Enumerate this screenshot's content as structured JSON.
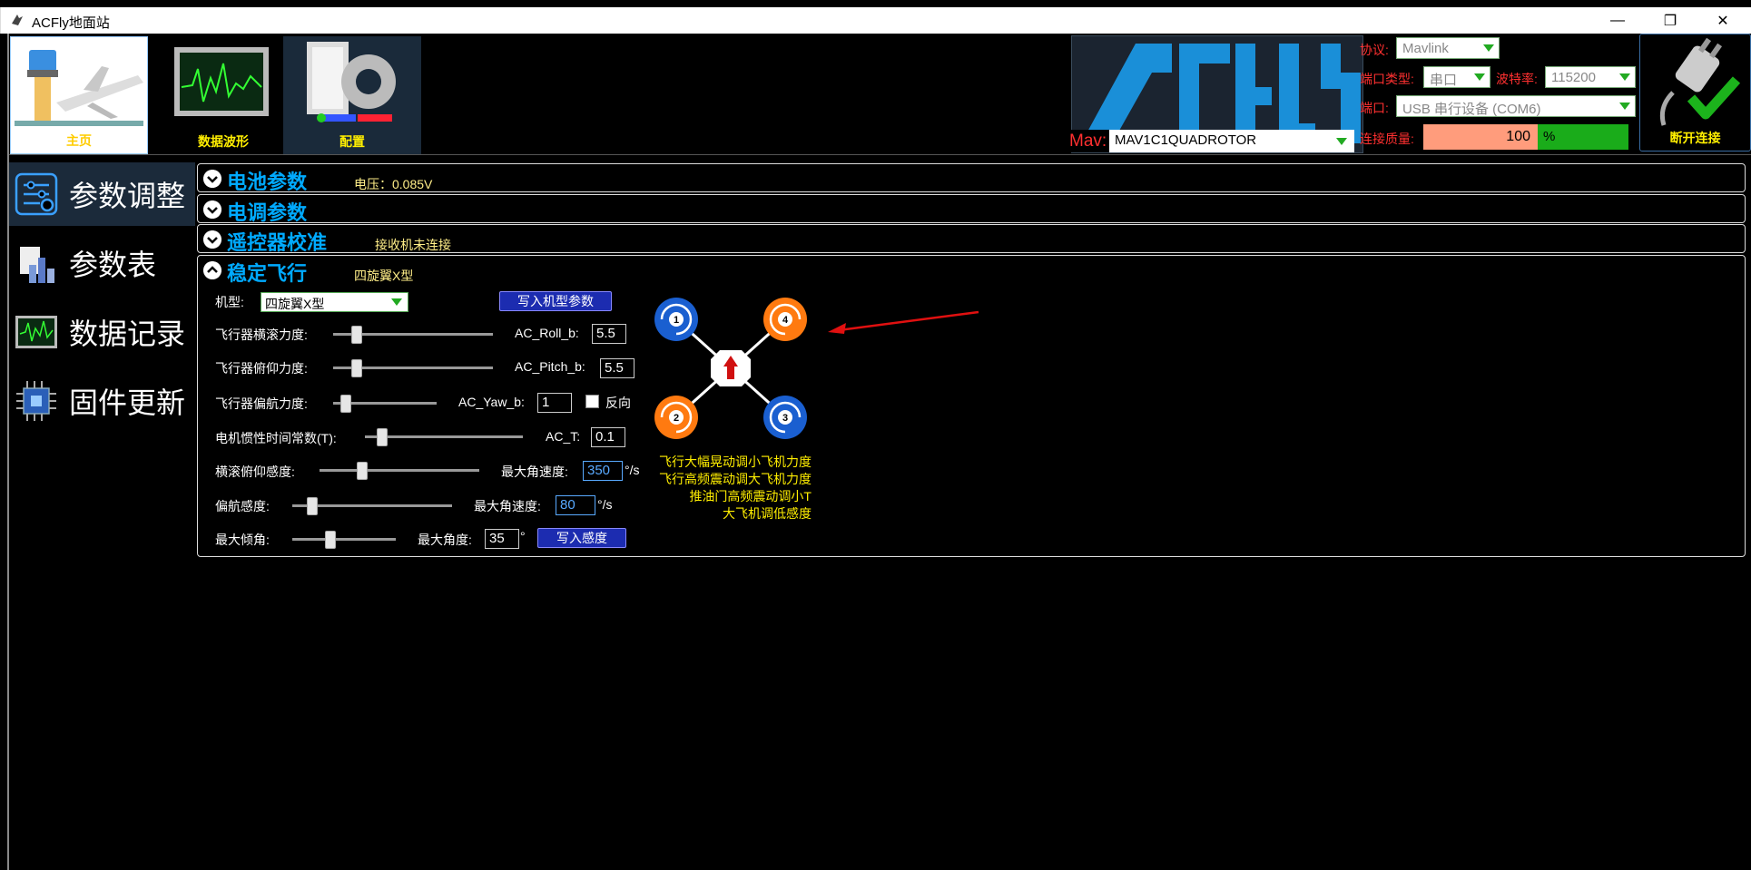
{
  "window": {
    "title": "ACFly地面站",
    "minimize": "—",
    "maximize": "❐",
    "close": "✕"
  },
  "toolbar": {
    "home_label": "主页",
    "wave_label": "数据波形",
    "config_label": "配置",
    "disconnect_label": "断开连接"
  },
  "connection": {
    "protocol_label": "协议:",
    "protocol_value": "Mavlink",
    "port_type_label": "端口类型:",
    "port_type_value": "串口",
    "baud_label": "波特率:",
    "baud_value": "115200",
    "port_label": "端口:",
    "port_value": "USB 串行设备 (COM6)",
    "quality_label": "连接质量:",
    "quality_value": "100",
    "quality_unit": "%",
    "mav_label": "Mav:",
    "mav_value": "MAV1C1QUADROTOR"
  },
  "sidebar": {
    "items": [
      {
        "label": "参数调整",
        "icon": "sliders-icon"
      },
      {
        "label": "参数表",
        "icon": "bar-chart-icon"
      },
      {
        "label": "数据记录",
        "icon": "monitor-wave-icon"
      },
      {
        "label": "固件更新",
        "icon": "chip-icon"
      }
    ]
  },
  "panels": {
    "battery": {
      "title": "电池参数",
      "sub": "电压：0.085V"
    },
    "esc": {
      "title": "电调参数"
    },
    "rc": {
      "title": "遥控器校准",
      "sub": "接收机未连接"
    },
    "stable": {
      "title": "稳定飞行",
      "sub": "四旋翼X型",
      "frame_label": "机型:",
      "frame_value": "四旋翼X型",
      "write_frame_button": "写入机型参数",
      "roll_label": "飞行器横滚力度:",
      "roll_param": "AC_Roll_b:",
      "roll_value": "5.5",
      "roll_pos": 0.12,
      "pitch_label": "飞行器俯仰力度:",
      "pitch_param": "AC_Pitch_b:",
      "pitch_value": "5.5",
      "pitch_pos": 0.12,
      "yaw_label": "飞行器偏航力度:",
      "yaw_param": "AC_Yaw_b:",
      "yaw_value": "1",
      "reverse_label": "反向",
      "yaw_pos": 0.08,
      "motor_label": "电机惯性时间常数(T):",
      "motor_param": "AC_T:",
      "motor_value": "0.1",
      "motor_pos": 0.08,
      "rp_sens_label": "横滚俯仰感度:",
      "max_rate_label": "最大角速度:",
      "rp_max_rate": "350",
      "rate_unit": "°/s",
      "rp_pos": 0.25,
      "yaw_sens_label": "偏航感度:",
      "yaw_max_rate_label": "最大角速度:",
      "yaw_max_rate": "80",
      "yaw_sens_pos": 0.1,
      "max_tilt_label": "最大倾角:",
      "max_angle_label": "最大角度:",
      "max_angle": "35",
      "angle_unit": "°",
      "tilt_pos": 0.35,
      "write_sens_button": "写入感度",
      "hints": [
        "飞行大幅晃动调小飞机力度",
        "飞行高频震动调大飞机力度",
        "推油门高频震动调小T",
        "大飞机调低感度"
      ],
      "motors": [
        "1",
        "4",
        "2",
        "3"
      ]
    }
  },
  "colors": {
    "accent": "#00aaff",
    "warn": "#ffee00",
    "motor_blue": "#1a5fd0",
    "motor_orange": "#ff7a10"
  }
}
